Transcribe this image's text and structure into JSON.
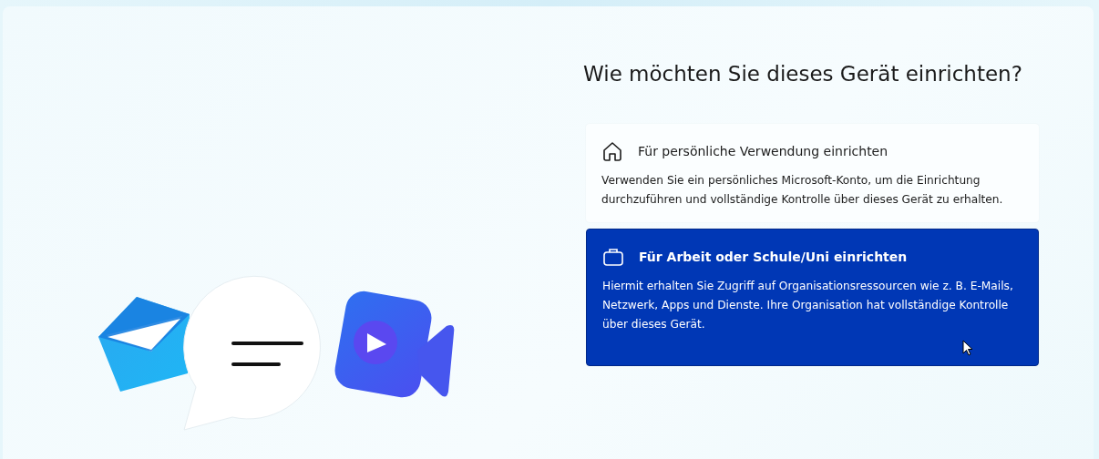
{
  "title": "Wie möchten Sie dieses Gerät einrichten?",
  "options": [
    {
      "kind": "personal",
      "selected": false,
      "heading": "Für persönliche Verwendung einrichten",
      "description": "Verwenden Sie ein persönliches Microsoft-Konto, um die Einrichtung durchzuführen und vollständige Kontrolle über dieses Gerät zu erhalten."
    },
    {
      "kind": "work",
      "selected": true,
      "heading": "Für Arbeit oder Schule/Uni einrichten",
      "description": "Hiermit erhalten Sie Zugriff auf Organisationsressourcen wie z. B. E-Mails, Netzwerk, Apps und Dienste. Ihre Organisation hat vollständige Kontrolle über dieses Gerät."
    }
  ]
}
